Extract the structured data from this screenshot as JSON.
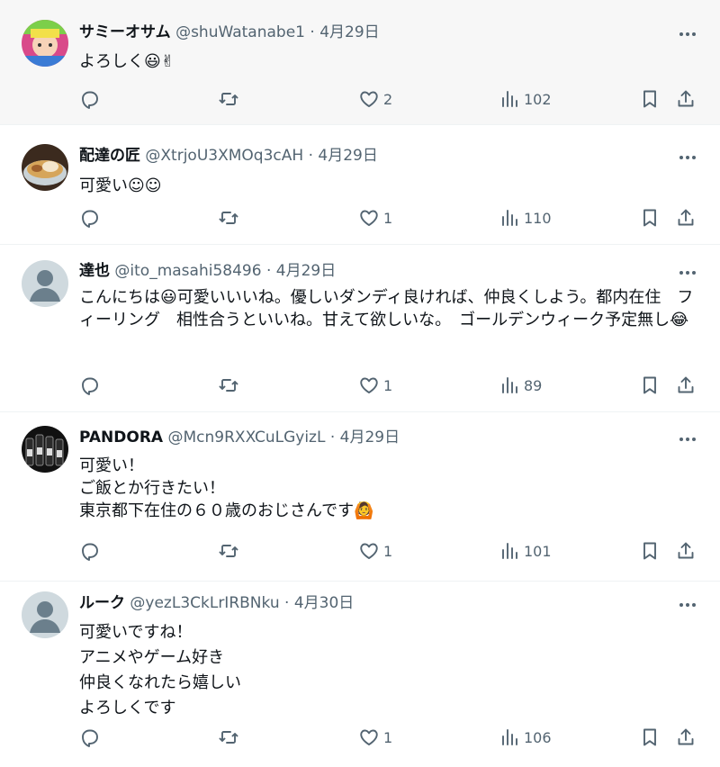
{
  "posts": [
    {
      "name": "サミーオサム",
      "handle": "@shuWatanabe1",
      "date": "4月29日",
      "text": "よろしく😃✌",
      "likes": "2",
      "views": "102",
      "avatar": "colorful-anime-avatar",
      "highlighted": true
    },
    {
      "name": "配達の匠",
      "handle": "@XtrjoU3XMOq3cAH",
      "date": "4月29日",
      "text": "可愛い☺☺",
      "likes": "1",
      "views": "110",
      "avatar": "food-bowl-avatar"
    },
    {
      "name": "達也",
      "handle": "@ito_masahi58496",
      "date": "4月29日",
      "text": "こんにちは😃可愛いいいね。優しいダンディ良ければ、仲良くしよう。都内在住　フィーリング　相性合うといいね。甘えて欲しいな。　ゴールデンウィーク予定無し😂",
      "likes": "1",
      "views": "89",
      "avatar": "default-avatar"
    },
    {
      "name": "PANDORA",
      "handle": "@Mcn9RXXCuLGyizL",
      "date": "4月29日",
      "text": "可愛い！\nご飯とか行きたい！\n東京都下在住の６０歳のおじさんです🙆",
      "likes": "1",
      "views": "101",
      "avatar": "bottles-avatar"
    },
    {
      "name": "ルーク",
      "handle": "@yezL3CkLrIRBNku",
      "date": "4月30日",
      "text": "可愛いですね！\nアニメやゲーム好き\n仲良くなれたら嬉しい\nよろしくです",
      "likes": "1",
      "views": "106",
      "avatar": "default-avatar"
    }
  ],
  "meta_separator": "·",
  "icons": {
    "more": "more-dots-icon",
    "reply": "reply-icon",
    "retweet": "retweet-icon",
    "like": "heart-icon",
    "views": "views-bar-chart-icon",
    "bookmark": "bookmark-icon",
    "share": "share-icon"
  },
  "colors": {
    "text": "#0f1419",
    "secondary": "#536471",
    "highlight_bg": "#f7f7f7",
    "border": "#eff3f4"
  }
}
